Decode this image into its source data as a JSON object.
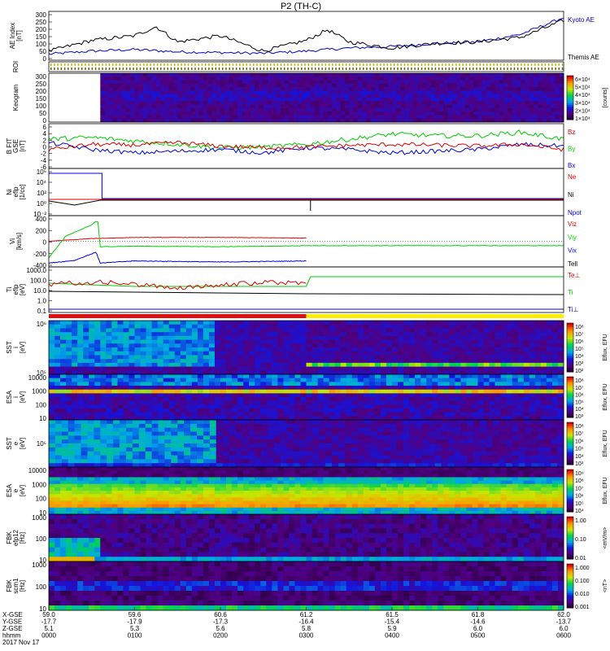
{
  "title": "P2 (TH-C)",
  "colors": {
    "kyoto": "#0000cc",
    "themis": "#000000",
    "red": "#dd0000",
    "green": "#00cc00",
    "blue": "#0000dd",
    "black": "#000000",
    "bar_red": "#dd1111",
    "bar_yellow": "#ffee00"
  },
  "xaxis": {
    "row_labels": [
      "X-GSE",
      "Y-GSE",
      "Z-GSE",
      "hhmm",
      "2017 Nov 17"
    ],
    "ticks": [
      {
        "x": "59.0",
        "y": "-17.7",
        "z": "5.1",
        "hhmm": "0000"
      },
      {
        "x": "59.6",
        "y": "-17.9",
        "z": "5.3",
        "hhmm": "0100"
      },
      {
        "x": "60.6",
        "y": "-17.3",
        "z": "5.6",
        "hhmm": "0200"
      },
      {
        "x": "61.2",
        "y": "-16.4",
        "z": "5.8",
        "hhmm": "0300"
      },
      {
        "x": "61.5",
        "y": "-15.4",
        "z": "5.9",
        "hhmm": "0400"
      },
      {
        "x": "61.8",
        "y": "-14.6",
        "z": "6.0",
        "hhmm": "0500"
      },
      {
        "x": "62.0",
        "y": "-13.7",
        "z": "6.0",
        "hhmm": "0600"
      }
    ]
  },
  "panels": [
    {
      "id": "ae",
      "ylabel": [
        "AE Index",
        "[nT]"
      ],
      "ticks": [
        "300",
        "250",
        "200",
        "150",
        "100",
        "50",
        "0"
      ],
      "legend": [
        {
          "text": "Kyoto AE",
          "color": "#0000cc"
        },
        {
          "text": "Themis AE",
          "color": "#000000"
        }
      ]
    },
    {
      "id": "roi",
      "ylabel": [
        "ROI"
      ],
      "ticks": [],
      "legend": []
    },
    {
      "id": "keogram",
      "ylabel": [
        "Keogram"
      ],
      "ticks": [
        "300",
        "250",
        "200",
        "150",
        "100",
        "50",
        "0"
      ],
      "colorbar": {
        "ticks": [
          "6×10⁴",
          "5×10⁴",
          "4×10⁴",
          "3×10⁴",
          "2×10⁴",
          "1×10⁴"
        ],
        "label": "[counts]"
      },
      "legend": []
    },
    {
      "id": "bfield",
      "ylabel": [
        "B FIT",
        "GSE",
        "[nT]"
      ],
      "ticks": [
        "6",
        "4",
        "2",
        "0",
        "-2",
        "-4",
        "-6"
      ],
      "legend": [
        {
          "text": "Bz",
          "color": "#dd0000"
        },
        {
          "text": "By",
          "color": "#00cc00"
        },
        {
          "text": "Bx",
          "color": "#0000dd"
        }
      ]
    },
    {
      "id": "density",
      "ylabel": [
        "Ni",
        "eflp",
        "[1/cc]"
      ],
      "ticks": [
        "10⁶",
        "10⁴",
        "10²",
        "10⁰",
        "10⁻²"
      ],
      "legend": [
        {
          "text": "Ne",
          "color": "#dd0000"
        },
        {
          "text": "Ni",
          "color": "#000000"
        },
        {
          "text": "Npot",
          "color": "#0000dd"
        }
      ]
    },
    {
      "id": "velocity",
      "ylabel": [
        "Vi",
        "[km/s]"
      ],
      "ticks": [
        "400",
        "200",
        "0",
        "-200",
        "-400"
      ],
      "legend": [
        {
          "text": "Viz",
          "color": "#dd0000"
        },
        {
          "text": "Viy",
          "color": "#00cc00"
        },
        {
          "text": "Vix",
          "color": "#0000dd"
        },
        {
          "text": "Tell",
          "color": "#000000"
        }
      ]
    },
    {
      "id": "temp",
      "ylabel": [
        "Ti",
        "eflp",
        "[eV]"
      ],
      "ticks": [
        "1000.0",
        "100.0",
        "10.0",
        "1.0",
        "0.1"
      ],
      "legend": [
        {
          "text": "Te⊥",
          "color": "#dd0000"
        },
        {
          "text": "Ti",
          "color": "#00cc00"
        },
        {
          "text": "Ti⊥",
          "color": "#0000dd"
        }
      ]
    },
    {
      "id": "mode",
      "ylabel": [],
      "ticks": [],
      "legend": []
    },
    {
      "id": "sst_i",
      "ylabel": [
        "SST",
        "i",
        "[eV]"
      ],
      "ticks": [
        "10⁶",
        "10⁵"
      ],
      "colorbar": {
        "ticks": [
          "10⁸",
          "10⁷",
          "10⁶",
          "10⁵",
          "10⁴",
          "10³",
          "10²"
        ],
        "label": "Eflux, EFU"
      },
      "legend": []
    },
    {
      "id": "esa_i",
      "ylabel": [
        "ESA",
        "i",
        "[eV]"
      ],
      "ticks": [
        "10000",
        "1000",
        "100",
        "10"
      ],
      "colorbar": {
        "ticks": [
          "10⁸",
          "10⁷",
          "10⁶",
          "10⁵",
          "10⁴",
          "10³"
        ],
        "label": "Eflux, EFU"
      },
      "legend": []
    },
    {
      "id": "sst_e",
      "ylabel": [
        "SST",
        "e",
        "[eV]"
      ],
      "ticks": [
        "10⁵"
      ],
      "colorbar": {
        "ticks": [
          "10⁸",
          "10⁷",
          "10⁶",
          "10⁵",
          "10⁴",
          "10³"
        ],
        "label": "Eflux, EFU"
      },
      "legend": []
    },
    {
      "id": "esa_e",
      "ylabel": [
        "ESA",
        "e",
        "[eV]"
      ],
      "ticks": [
        "10000",
        "1000",
        "100",
        "10"
      ],
      "colorbar": {
        "ticks": [
          "10⁹",
          "10⁸",
          "10⁷",
          "10⁶",
          "10⁵",
          "10⁴"
        ],
        "label": "Eflux, EFU"
      },
      "legend": []
    },
    {
      "id": "fbk_e",
      "ylabel": [
        "FBK",
        "efp12",
        "[Hz]"
      ],
      "ticks": [
        "1000",
        "100",
        "10"
      ],
      "colorbar": {
        "ticks": [
          "1.00",
          "0.10",
          "0.01"
        ],
        "label": "<mV/m>"
      },
      "legend": []
    },
    {
      "id": "fbk_b",
      "ylabel": [
        "FBK",
        "scm1",
        "[Hz]"
      ],
      "ticks": [
        "1000",
        "100",
        "10"
      ],
      "colorbar": {
        "ticks": [
          "1.000",
          "0.100",
          "0.010",
          "0.001"
        ],
        "label": "<nT>"
      },
      "legend": []
    }
  ],
  "chart_data": {
    "type": "line",
    "title": "P2 (TH-C)",
    "x_hours_ticks": [
      "0000",
      "0100",
      "0200",
      "0300",
      "0400",
      "0500",
      "0600"
    ],
    "series": [
      {
        "name": "Kyoto AE",
        "x_hours": [
          0,
          0.5,
          1,
          1.5,
          2,
          2.5,
          3,
          3.5,
          4,
          4.5,
          5,
          5.5,
          6
        ],
        "values": [
          40,
          60,
          70,
          55,
          50,
          45,
          60,
          80,
          90,
          110,
          120,
          170,
          280
        ]
      },
      {
        "name": "Themis AE",
        "x_hours": [
          0,
          0.5,
          1,
          1.25,
          1.5,
          2,
          2.5,
          3,
          3.25,
          3.5,
          4,
          4.5,
          5,
          5.5,
          6
        ],
        "values": [
          60,
          130,
          160,
          220,
          120,
          160,
          60,
          130,
          200,
          120,
          80,
          110,
          120,
          150,
          260
        ]
      },
      {
        "name": "Bz",
        "x_hours": [
          0,
          0.5,
          1,
          1.5,
          2,
          2.5,
          3,
          3.5,
          4,
          4.5,
          5,
          5.5,
          6
        ],
        "values": [
          -1,
          0.5,
          0.3,
          1,
          0,
          -0.5,
          -0.3,
          0.2,
          0.5,
          0.3,
          0,
          0.5,
          -1
        ]
      },
      {
        "name": "By",
        "x_hours": [
          0,
          0.5,
          1,
          1.5,
          2,
          2.5,
          3,
          3.5,
          4,
          4.5,
          5,
          5.5,
          6
        ],
        "values": [
          2,
          2.5,
          1.5,
          0.5,
          -0.5,
          -0.3,
          0.5,
          2,
          3.5,
          3,
          3,
          4,
          2
        ]
      },
      {
        "name": "Bx",
        "x_hours": [
          0,
          0.5,
          1,
          1.5,
          2,
          2.5,
          3,
          3.5,
          4,
          4.5,
          5,
          5.5,
          6
        ],
        "values": [
          1,
          -1,
          -2,
          -1.5,
          -1,
          -2,
          -0.5,
          -1,
          -2,
          -1.5,
          -1,
          0.5,
          0
        ]
      },
      {
        "name": "Viz",
        "x_hours": [
          0,
          0.5,
          1,
          2,
          3
        ],
        "values": [
          0,
          50,
          70,
          70,
          60
        ]
      },
      {
        "name": "Viy",
        "x_hours": [
          0,
          0.2,
          0.5,
          0.57,
          0.6,
          1,
          2,
          3,
          6
        ],
        "values": [
          -300,
          100,
          300,
          400,
          -100,
          -90,
          -100,
          -80,
          -80
        ]
      },
      {
        "name": "Vix",
        "x_hours": [
          0,
          0.3,
          0.55,
          0.6,
          1,
          2,
          3
        ],
        "values": [
          -400,
          -350,
          -200,
          -400,
          -360,
          -380,
          -360
        ]
      }
    ],
    "mode_bar": [
      {
        "from_hours": 0,
        "to_hours": 3,
        "color": "#dd1111"
      },
      {
        "from_hours": 3,
        "to_hours": 6,
        "color": "#ffee00"
      }
    ]
  }
}
